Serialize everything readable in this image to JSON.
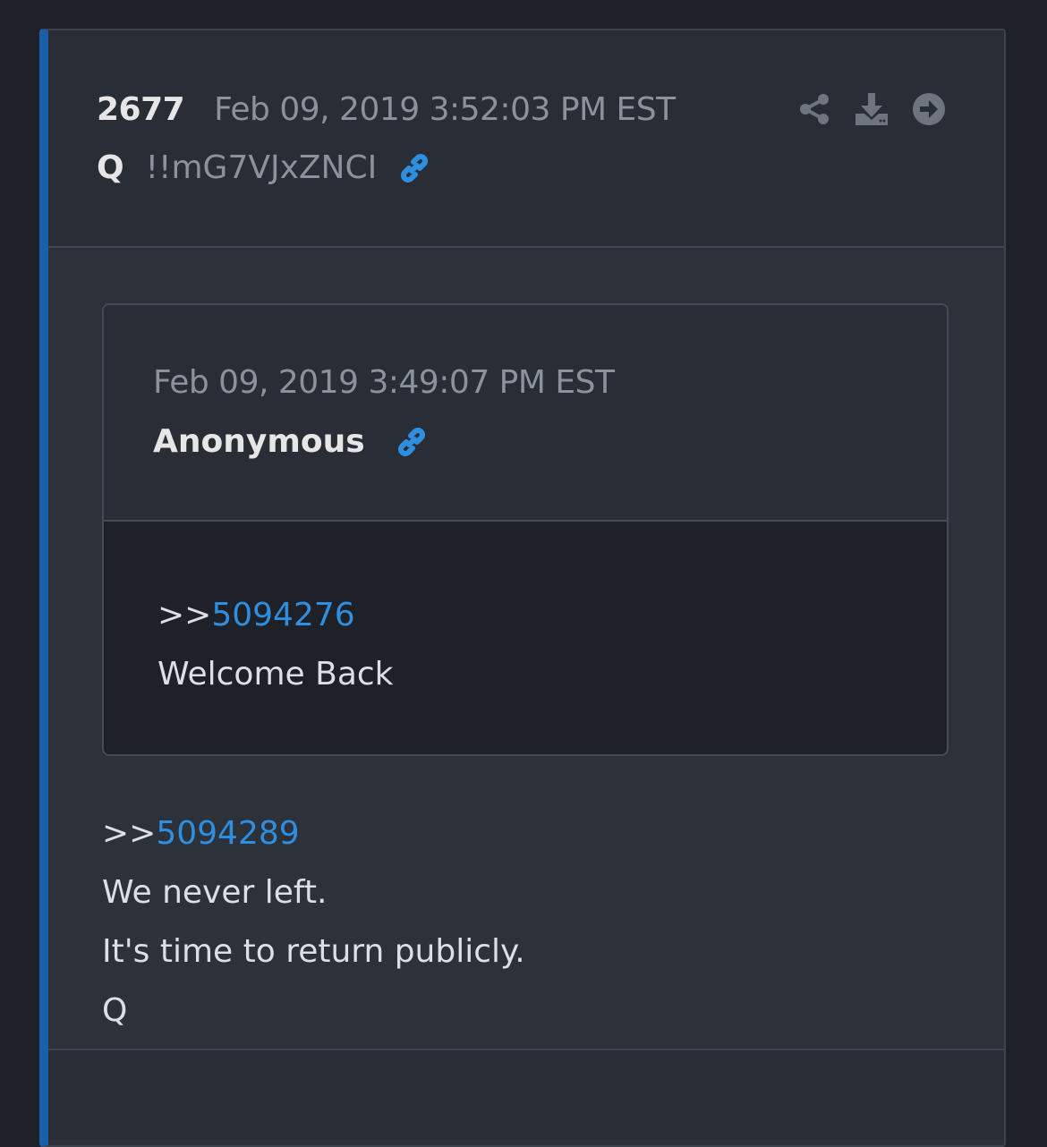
{
  "post": {
    "number": "2677",
    "date": "Feb 09, 2019 3:52:03 PM EST",
    "author": "Q",
    "tripcode": "!!mG7VJxZNCI",
    "icons": [
      "link-icon",
      "share-icon",
      "download-icon",
      "arrow-right-circle-icon"
    ]
  },
  "quote": {
    "date": "Feb 09, 2019 3:49:07 PM EST",
    "author": "Anonymous",
    "ref_prefix": ">>",
    "ref_id": "5094276",
    "text": "Welcome Back"
  },
  "body": {
    "ref_prefix": ">>",
    "ref_id": "5094289",
    "lines": [
      "We never left.",
      "It's time to return publicly.",
      "Q"
    ]
  },
  "colors": {
    "accent": "#1a5fa8",
    "link": "#2e8fe0",
    "background": "#1e2129",
    "card": "#2c313a"
  }
}
